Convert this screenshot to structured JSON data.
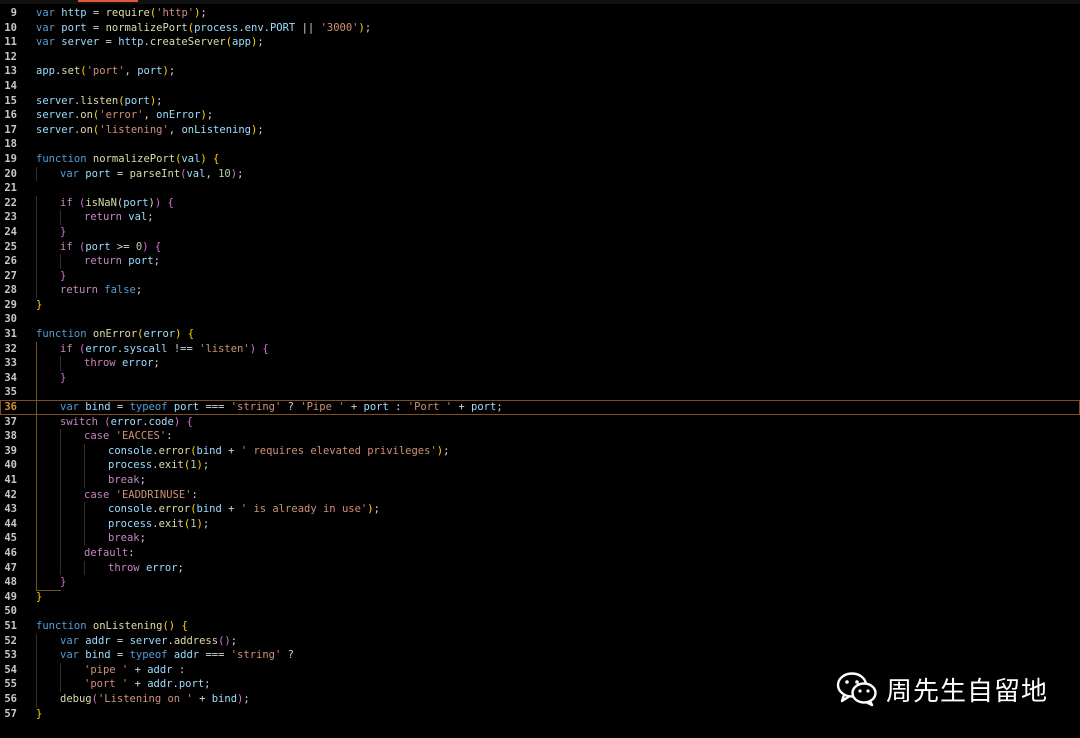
{
  "editor": {
    "current_line": 36,
    "lines": [
      {
        "n": 9,
        "t": [
          [
            "k",
            "var"
          ],
          [
            "p",
            " "
          ],
          [
            "v",
            "http"
          ],
          [
            "p",
            " = "
          ],
          [
            "f",
            "require"
          ],
          [
            "y",
            "("
          ],
          [
            "s",
            "'http'"
          ],
          [
            "y",
            ")"
          ],
          [
            "p",
            ";"
          ]
        ]
      },
      {
        "n": 10,
        "t": [
          [
            "k",
            "var"
          ],
          [
            "p",
            " "
          ],
          [
            "v",
            "port"
          ],
          [
            "p",
            " = "
          ],
          [
            "f",
            "normalizePort"
          ],
          [
            "y",
            "("
          ],
          [
            "v",
            "process"
          ],
          [
            "p",
            "."
          ],
          [
            "v",
            "env"
          ],
          [
            "p",
            "."
          ],
          [
            "v",
            "PORT"
          ],
          [
            "p",
            " || "
          ],
          [
            "s",
            "'3000'"
          ],
          [
            "y",
            ")"
          ],
          [
            "p",
            ";"
          ]
        ]
      },
      {
        "n": 11,
        "t": [
          [
            "k",
            "var"
          ],
          [
            "p",
            " "
          ],
          [
            "v",
            "server"
          ],
          [
            "p",
            " = "
          ],
          [
            "v",
            "http"
          ],
          [
            "p",
            "."
          ],
          [
            "f",
            "createServer"
          ],
          [
            "y",
            "("
          ],
          [
            "v",
            "app"
          ],
          [
            "y",
            ")"
          ],
          [
            "p",
            ";"
          ]
        ]
      },
      {
        "n": 12,
        "t": []
      },
      {
        "n": 13,
        "t": [
          [
            "v",
            "app"
          ],
          [
            "p",
            "."
          ],
          [
            "f",
            "set"
          ],
          [
            "y",
            "("
          ],
          [
            "s",
            "'port'"
          ],
          [
            "p",
            ", "
          ],
          [
            "v",
            "port"
          ],
          [
            "y",
            ")"
          ],
          [
            "p",
            ";"
          ]
        ]
      },
      {
        "n": 14,
        "t": []
      },
      {
        "n": 15,
        "t": [
          [
            "v",
            "server"
          ],
          [
            "p",
            "."
          ],
          [
            "f",
            "listen"
          ],
          [
            "y",
            "("
          ],
          [
            "v",
            "port"
          ],
          [
            "y",
            ")"
          ],
          [
            "p",
            ";"
          ]
        ]
      },
      {
        "n": 16,
        "t": [
          [
            "v",
            "server"
          ],
          [
            "p",
            "."
          ],
          [
            "f",
            "on"
          ],
          [
            "y",
            "("
          ],
          [
            "s",
            "'error'"
          ],
          [
            "p",
            ", "
          ],
          [
            "v",
            "onError"
          ],
          [
            "y",
            ")"
          ],
          [
            "p",
            ";"
          ]
        ]
      },
      {
        "n": 17,
        "t": [
          [
            "v",
            "server"
          ],
          [
            "p",
            "."
          ],
          [
            "f",
            "on"
          ],
          [
            "y",
            "("
          ],
          [
            "s",
            "'listening'"
          ],
          [
            "p",
            ", "
          ],
          [
            "v",
            "onListening"
          ],
          [
            "y",
            ")"
          ],
          [
            "p",
            ";"
          ]
        ]
      },
      {
        "n": 18,
        "t": []
      },
      {
        "n": 19,
        "t": [
          [
            "k",
            "function"
          ],
          [
            "p",
            " "
          ],
          [
            "f",
            "normalizePort"
          ],
          [
            "y",
            "("
          ],
          [
            "v",
            "val"
          ],
          [
            "y",
            ")"
          ],
          [
            "p",
            " "
          ],
          [
            "y",
            "{"
          ]
        ]
      },
      {
        "n": 20,
        "i": 1,
        "t": [
          [
            "k",
            "var"
          ],
          [
            "p",
            " "
          ],
          [
            "v",
            "port"
          ],
          [
            "p",
            " = "
          ],
          [
            "f",
            "parseInt"
          ],
          [
            "g",
            "("
          ],
          [
            "v",
            "val"
          ],
          [
            "p",
            ", "
          ],
          [
            "n",
            "10"
          ],
          [
            "g",
            ")"
          ],
          [
            "p",
            ";"
          ]
        ]
      },
      {
        "n": 21,
        "t": []
      },
      {
        "n": 22,
        "i": 1,
        "t": [
          [
            "c",
            "if"
          ],
          [
            "p",
            " "
          ],
          [
            "g",
            "("
          ],
          [
            "f",
            "isNaN"
          ],
          [
            "p",
            "("
          ],
          [
            "v",
            "port"
          ],
          [
            "p",
            ")"
          ],
          [
            "g",
            ")"
          ],
          [
            "p",
            " "
          ],
          [
            "g",
            "{"
          ]
        ]
      },
      {
        "n": 23,
        "i": 2,
        "t": [
          [
            "c",
            "return"
          ],
          [
            "p",
            " "
          ],
          [
            "v",
            "val"
          ],
          [
            "p",
            ";"
          ]
        ]
      },
      {
        "n": 24,
        "i": 1,
        "t": [
          [
            "g",
            "}"
          ]
        ]
      },
      {
        "n": 25,
        "i": 1,
        "t": [
          [
            "c",
            "if"
          ],
          [
            "p",
            " "
          ],
          [
            "g",
            "("
          ],
          [
            "v",
            "port"
          ],
          [
            "p",
            " >= "
          ],
          [
            "n",
            "0"
          ],
          [
            "g",
            ")"
          ],
          [
            "p",
            " "
          ],
          [
            "g",
            "{"
          ]
        ]
      },
      {
        "n": 26,
        "i": 2,
        "t": [
          [
            "c",
            "return"
          ],
          [
            "p",
            " "
          ],
          [
            "v",
            "port"
          ],
          [
            "p",
            ";"
          ]
        ]
      },
      {
        "n": 27,
        "i": 1,
        "t": [
          [
            "g",
            "}"
          ]
        ]
      },
      {
        "n": 28,
        "i": 1,
        "t": [
          [
            "c",
            "return"
          ],
          [
            "p",
            " "
          ],
          [
            "k",
            "false"
          ],
          [
            "p",
            ";"
          ]
        ]
      },
      {
        "n": 29,
        "t": [
          [
            "y",
            "}"
          ]
        ]
      },
      {
        "n": 30,
        "t": []
      },
      {
        "n": 31,
        "t": [
          [
            "k",
            "function"
          ],
          [
            "p",
            " "
          ],
          [
            "f",
            "onError"
          ],
          [
            "y",
            "("
          ],
          [
            "v",
            "error"
          ],
          [
            "y",
            ")"
          ],
          [
            "p",
            " "
          ],
          [
            "y",
            "{"
          ]
        ]
      },
      {
        "n": 32,
        "i": 1,
        "t": [
          [
            "c",
            "if"
          ],
          [
            "p",
            " "
          ],
          [
            "g",
            "("
          ],
          [
            "v",
            "error"
          ],
          [
            "p",
            "."
          ],
          [
            "v",
            "syscall"
          ],
          [
            "p",
            " !== "
          ],
          [
            "s",
            "'listen'"
          ],
          [
            "g",
            ")"
          ],
          [
            "p",
            " "
          ],
          [
            "g",
            "{"
          ]
        ]
      },
      {
        "n": 33,
        "i": 2,
        "t": [
          [
            "c",
            "throw"
          ],
          [
            "p",
            " "
          ],
          [
            "v",
            "error"
          ],
          [
            "p",
            ";"
          ]
        ]
      },
      {
        "n": 34,
        "i": 1,
        "t": [
          [
            "g",
            "}"
          ]
        ]
      },
      {
        "n": 35,
        "t": []
      },
      {
        "n": 36,
        "i": 1,
        "t": [
          [
            "k",
            "var"
          ],
          [
            "p",
            " "
          ],
          [
            "v",
            "bind"
          ],
          [
            "p",
            " = "
          ],
          [
            "k",
            "typeof"
          ],
          [
            "p",
            " "
          ],
          [
            "v",
            "port"
          ],
          [
            "p",
            " === "
          ],
          [
            "s",
            "'string'"
          ],
          [
            "p",
            " ? "
          ],
          [
            "s",
            "'Pipe '"
          ],
          [
            "p",
            " + "
          ],
          [
            "v",
            "port"
          ],
          [
            "p",
            " : "
          ],
          [
            "s",
            "'Port '"
          ],
          [
            "p",
            " + "
          ],
          [
            "v",
            "port"
          ],
          [
            "p",
            ";"
          ]
        ]
      },
      {
        "n": 37,
        "i": 1,
        "t": [
          [
            "c",
            "switch"
          ],
          [
            "p",
            " "
          ],
          [
            "g",
            "("
          ],
          [
            "v",
            "error"
          ],
          [
            "p",
            "."
          ],
          [
            "v",
            "code"
          ],
          [
            "g",
            ")"
          ],
          [
            "p",
            " "
          ],
          [
            "g",
            "{"
          ]
        ]
      },
      {
        "n": 38,
        "i": 2,
        "t": [
          [
            "c",
            "case"
          ],
          [
            "p",
            " "
          ],
          [
            "s",
            "'EACCES'"
          ],
          [
            "p",
            ":"
          ]
        ]
      },
      {
        "n": 39,
        "i": 3,
        "t": [
          [
            "v",
            "console"
          ],
          [
            "p",
            "."
          ],
          [
            "f",
            "error"
          ],
          [
            "y",
            "("
          ],
          [
            "v",
            "bind"
          ],
          [
            "p",
            " + "
          ],
          [
            "s",
            "' requires elevated privileges'"
          ],
          [
            "y",
            ")"
          ],
          [
            "p",
            ";"
          ]
        ]
      },
      {
        "n": 40,
        "i": 3,
        "t": [
          [
            "v",
            "process"
          ],
          [
            "p",
            "."
          ],
          [
            "f",
            "exit"
          ],
          [
            "y",
            "("
          ],
          [
            "n",
            "1"
          ],
          [
            "y",
            ")"
          ],
          [
            "p",
            ";"
          ]
        ]
      },
      {
        "n": 41,
        "i": 3,
        "t": [
          [
            "c",
            "break"
          ],
          [
            "p",
            ";"
          ]
        ]
      },
      {
        "n": 42,
        "i": 2,
        "t": [
          [
            "c",
            "case"
          ],
          [
            "p",
            " "
          ],
          [
            "s",
            "'EADDRINUSE'"
          ],
          [
            "p",
            ":"
          ]
        ]
      },
      {
        "n": 43,
        "i": 3,
        "t": [
          [
            "v",
            "console"
          ],
          [
            "p",
            "."
          ],
          [
            "f",
            "error"
          ],
          [
            "y",
            "("
          ],
          [
            "v",
            "bind"
          ],
          [
            "p",
            " + "
          ],
          [
            "s",
            "' is already in use'"
          ],
          [
            "y",
            ")"
          ],
          [
            "p",
            ";"
          ]
        ]
      },
      {
        "n": 44,
        "i": 3,
        "t": [
          [
            "v",
            "process"
          ],
          [
            "p",
            "."
          ],
          [
            "f",
            "exit"
          ],
          [
            "y",
            "("
          ],
          [
            "n",
            "1"
          ],
          [
            "y",
            ")"
          ],
          [
            "p",
            ";"
          ]
        ]
      },
      {
        "n": 45,
        "i": 3,
        "t": [
          [
            "c",
            "break"
          ],
          [
            "p",
            ";"
          ]
        ]
      },
      {
        "n": 46,
        "i": 2,
        "t": [
          [
            "c",
            "default"
          ],
          [
            "p",
            ":"
          ]
        ]
      },
      {
        "n": 47,
        "i": 3,
        "t": [
          [
            "c",
            "throw"
          ],
          [
            "p",
            " "
          ],
          [
            "v",
            "error"
          ],
          [
            "p",
            ";"
          ]
        ]
      },
      {
        "n": 48,
        "i": 1,
        "t": [
          [
            "g",
            "}"
          ]
        ]
      },
      {
        "n": 49,
        "t": [
          [
            "y",
            "}"
          ]
        ]
      },
      {
        "n": 50,
        "t": []
      },
      {
        "n": 51,
        "t": [
          [
            "k",
            "function"
          ],
          [
            "p",
            " "
          ],
          [
            "f",
            "onListening"
          ],
          [
            "y",
            "()"
          ],
          [
            "p",
            " "
          ],
          [
            "y",
            "{"
          ]
        ]
      },
      {
        "n": 52,
        "i": 1,
        "t": [
          [
            "k",
            "var"
          ],
          [
            "p",
            " "
          ],
          [
            "v",
            "addr"
          ],
          [
            "p",
            " = "
          ],
          [
            "v",
            "server"
          ],
          [
            "p",
            "."
          ],
          [
            "f",
            "address"
          ],
          [
            "g",
            "()"
          ],
          [
            "p",
            ";"
          ]
        ]
      },
      {
        "n": 53,
        "i": 1,
        "t": [
          [
            "k",
            "var"
          ],
          [
            "p",
            " "
          ],
          [
            "v",
            "bind"
          ],
          [
            "p",
            " = "
          ],
          [
            "k",
            "typeof"
          ],
          [
            "p",
            " "
          ],
          [
            "v",
            "addr"
          ],
          [
            "p",
            " === "
          ],
          [
            "s",
            "'string'"
          ],
          [
            "p",
            " ?"
          ]
        ]
      },
      {
        "n": 54,
        "i": 2,
        "t": [
          [
            "s",
            "'pipe '"
          ],
          [
            "p",
            " + "
          ],
          [
            "v",
            "addr"
          ],
          [
            "p",
            " :"
          ]
        ]
      },
      {
        "n": 55,
        "i": 2,
        "t": [
          [
            "s",
            "'port '"
          ],
          [
            "p",
            " + "
          ],
          [
            "v",
            "addr"
          ],
          [
            "p",
            "."
          ],
          [
            "v",
            "port"
          ],
          [
            "p",
            ";"
          ]
        ]
      },
      {
        "n": 56,
        "i": 1,
        "t": [
          [
            "f",
            "debug"
          ],
          [
            "g",
            "("
          ],
          [
            "s",
            "'Listening on '"
          ],
          [
            "p",
            " + "
          ],
          [
            "v",
            "bind"
          ],
          [
            "g",
            ")"
          ],
          [
            "p",
            ";"
          ]
        ]
      },
      {
        "n": 57,
        "t": [
          [
            "y",
            "}"
          ]
        ]
      }
    ]
  },
  "watermark": {
    "icon": "wechat-icon",
    "text": "周先生自留地"
  }
}
